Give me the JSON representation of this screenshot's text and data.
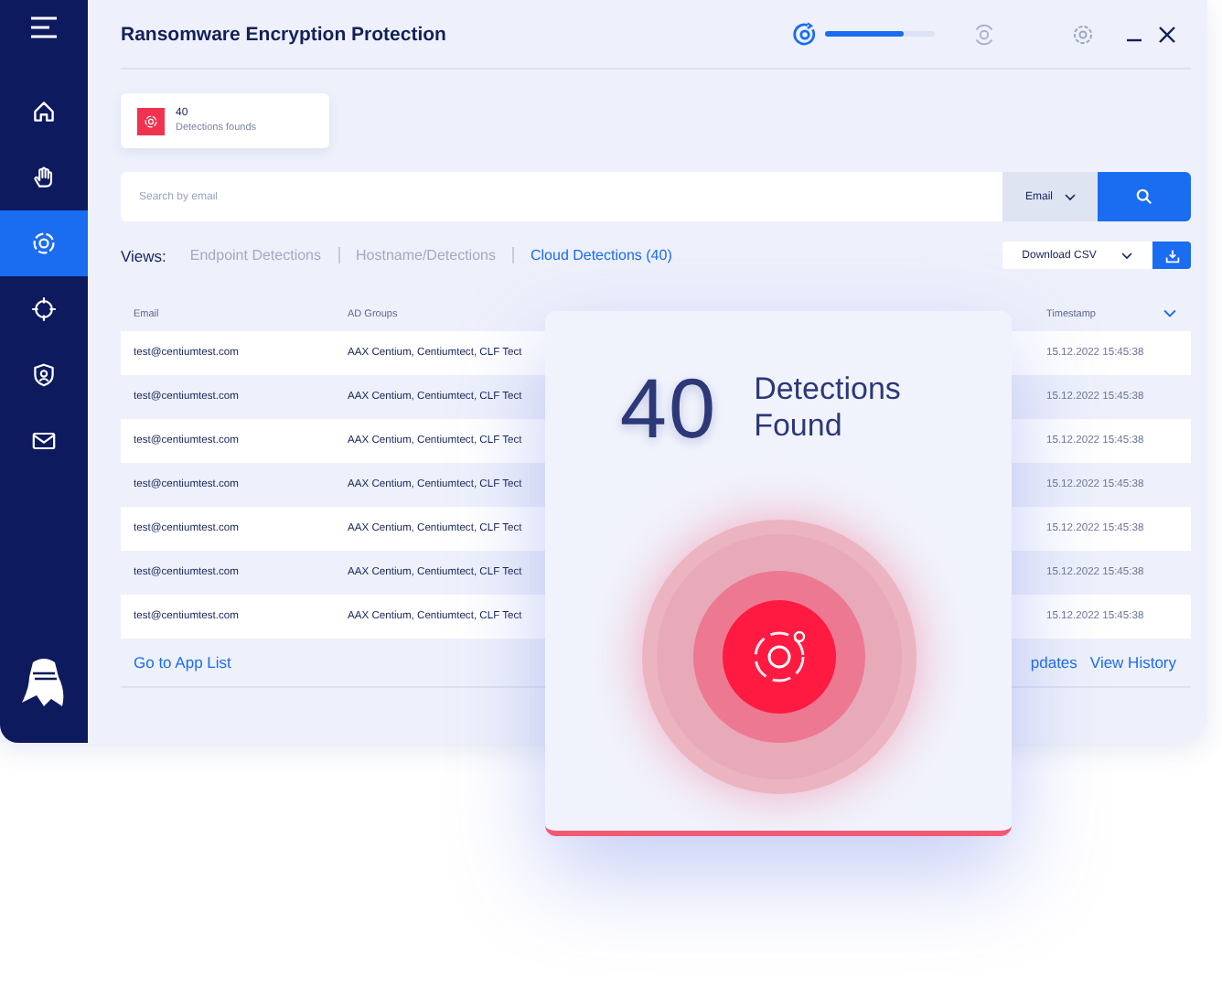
{
  "window": {
    "title": "Ransomware Encryption Protection"
  },
  "scan": {
    "level": 0.72
  },
  "sidebar": {
    "items": [
      {
        "kind": "home",
        "selected": false
      },
      {
        "kind": "hand",
        "selected": false
      },
      {
        "kind": "detection",
        "selected": true
      },
      {
        "kind": "crosshair",
        "selected": false
      },
      {
        "kind": "shield",
        "selected": false
      },
      {
        "kind": "mail",
        "selected": false
      }
    ]
  },
  "stat_card": {
    "count": "40",
    "label": "Detections founds"
  },
  "search": {
    "placeholder": "Search by email",
    "filter": "Email"
  },
  "views": {
    "label": "Views:",
    "tabs": [
      {
        "label": "Endpoint Detections",
        "selected": false
      },
      {
        "label": "Hostname/Detections",
        "selected": false
      },
      {
        "label": "Cloud Detections (40)",
        "selected": true
      }
    ]
  },
  "download": {
    "label": "Download CSV"
  },
  "table": {
    "columns": [
      "Email",
      "AD Groups",
      "Timestamp"
    ],
    "rows": [
      [
        "test@centiumtest.com",
        "AAX Centium, Centiumtect, CLF Tect",
        "15.12.2022 15:45:38"
      ],
      [
        "test@centiumtest.com",
        "AAX Centium, Centiumtect, CLF Tect",
        "15.12.2022 15:45:38"
      ],
      [
        "test@centiumtest.com",
        "AAX Centium, Centiumtect, CLF Tect",
        "15.12.2022 15:45:38"
      ],
      [
        "test@centiumtest.com",
        "AAX Centium, Centiumtect, CLF Tect",
        "15.12.2022 15:45:38"
      ],
      [
        "test@centiumtest.com",
        "AAX Centium, Centiumtect, CLF Tect",
        "15.12.2022 15:45:38"
      ],
      [
        "test@centiumtest.com",
        "AAX Centium, Centiumtect, CLF Tect",
        "15.12.2022 15:45:38"
      ],
      [
        "test@centiumtest.com",
        "AAX Centium, Centiumtect, CLF Tect",
        "15.12.2022 15:45:38"
      ]
    ]
  },
  "links": [
    "Go to App List",
    "pdates",
    "View History"
  ],
  "popup": {
    "count": "40",
    "label": "Detections Found"
  }
}
